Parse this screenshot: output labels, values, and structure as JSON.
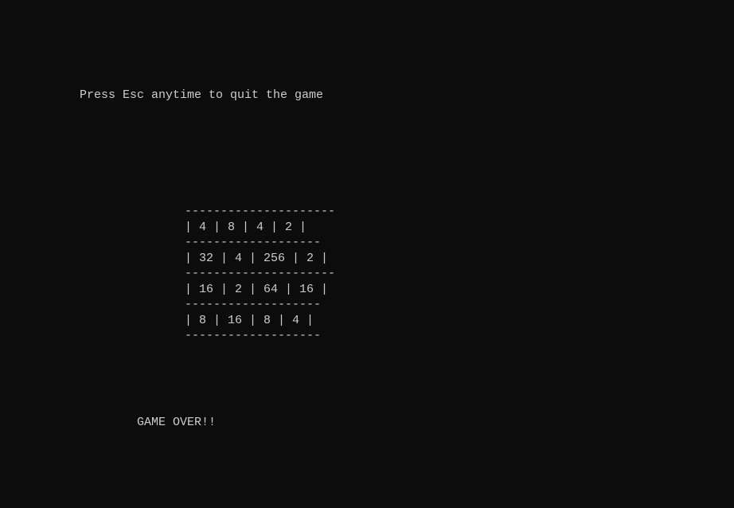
{
  "instruction": "Press Esc anytime to quit the game",
  "board": {
    "rows": [
      [
        4,
        8,
        4,
        2
      ],
      [
        32,
        4,
        256,
        2
      ],
      [
        16,
        2,
        64,
        16
      ],
      [
        8,
        16,
        8,
        4
      ]
    ],
    "separators": [
      "---------------------",
      "-------------------",
      "---------------------",
      "-------------------",
      "-------------------"
    ]
  },
  "rendered_rows": [
    "| 4 | 8 | 4 | 2 |",
    "| 32 | 4 | 256 | 2 |",
    "| 16 | 2 | 64 | 16 |",
    "| 8 | 16 | 8 | 4 |"
  ],
  "status": "GAME OVER!!"
}
